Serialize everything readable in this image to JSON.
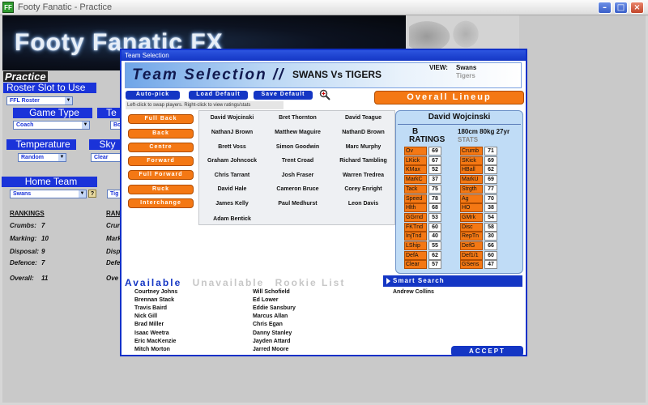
{
  "window": {
    "title": "Footy Fanatic - Practice",
    "icon": "FF"
  },
  "banner": {
    "title": "Footy Fanatic FX"
  },
  "left": {
    "heading": "Practice",
    "roster_label": "Roster Slot to Use",
    "roster_value": "FFL Roster",
    "game_type_label": "Game Type",
    "game_type_value": "Coach",
    "te_label": "Te",
    "te_value": "Bo",
    "temperature_label": "Temperature",
    "temperature_value": "Random",
    "sky_label": "Sky",
    "sky_value": "Clear",
    "home_team_label": "Home Team",
    "home_team_value": "Swans",
    "home_team_q": "?",
    "away_team_value": "Tig",
    "rankings_label": "RANKINGS",
    "rankings_label2": "RAN",
    "rankings": [
      {
        "label": "Crumbs:",
        "value": "7",
        "label2": "Crur"
      },
      {
        "label": "Marking:",
        "value": "10",
        "label2": "Mark"
      },
      {
        "label": "Disposal:",
        "value": "9",
        "label2": "Disp"
      },
      {
        "label": "Defence:",
        "value": "7",
        "label2": "Defe"
      }
    ],
    "overall_label": "Overall:",
    "overall_value": "11",
    "overall_label2": "Ove"
  },
  "dialog": {
    "title": "Team Selection",
    "header_title": "Team Selection //",
    "matchup": "SWANS Vs TIGERS",
    "view_label": "VIEW:",
    "view_primary": "Swans",
    "view_secondary": "Tigers",
    "buttons": {
      "autopick": "Auto-pick",
      "load": "Load Default",
      "save": "Save Default",
      "overall": "Overall Lineup",
      "accept": "ACCEPT"
    },
    "hint": "Left-click to swap players. Right-click to view ratings/stats",
    "positions": [
      "Full Back",
      "Back",
      "Centre",
      "Forward",
      "Full Forward",
      "Ruck",
      "Interchange"
    ],
    "grid": [
      [
        "David Wojcinski",
        "Bret Thornton",
        "David Teague"
      ],
      [
        "NathanJ Brown",
        "Matthew Maguire",
        "NathanD Brown"
      ],
      [
        "Brett Voss",
        "Simon Goodwin",
        "Marc Murphy"
      ],
      [
        "Graham Johncock",
        "Trent Croad",
        "Richard Tambling"
      ],
      [
        "Chris Tarrant",
        "Josh Fraser",
        "Warren Tredrea"
      ],
      [
        "David Hale",
        "Cameron Bruce",
        "Corey Enright"
      ],
      [
        "James Kelly",
        "Paul Medhurst",
        "Leon Davis"
      ],
      [
        "Adam Bentick",
        "",
        ""
      ]
    ],
    "player": {
      "name": "David Wojcinski",
      "b": "B",
      "ratings_label": "RATINGS",
      "physical": "180cm 80kg 27yr",
      "stats_label": "STATS",
      "left_ratings": [
        {
          "label": "Ov",
          "value": "69"
        },
        {
          "label": "LKick",
          "value": "67"
        },
        {
          "label": "KMax",
          "value": "52"
        },
        {
          "label": "MarkC",
          "value": "37"
        },
        {
          "label": "Tack",
          "value": "75"
        },
        {
          "label": "Speed",
          "value": "78"
        },
        {
          "label": "Hlth",
          "value": "68"
        },
        {
          "label": "GGrnd",
          "value": "53"
        },
        {
          "label": "FKTnd",
          "value": "60"
        },
        {
          "label": "InjTnd",
          "value": "40"
        },
        {
          "label": "LShip",
          "value": "55"
        },
        {
          "label": "DefA",
          "value": "62"
        },
        {
          "label": "Clear",
          "value": "57"
        }
      ],
      "right_ratings": [
        {
          "label": "Crumb",
          "value": "71"
        },
        {
          "label": "SKick",
          "value": "69"
        },
        {
          "label": "HBall",
          "value": "62"
        },
        {
          "label": "MarkU",
          "value": "69"
        },
        {
          "label": "Strgth",
          "value": "77"
        },
        {
          "label": "Ag",
          "value": "70"
        },
        {
          "label": "HO",
          "value": "38"
        },
        {
          "label": "GMrk",
          "value": "54"
        },
        {
          "label": "Disc",
          "value": "58"
        },
        {
          "label": "RepTn",
          "value": "30"
        },
        {
          "label": "DefG",
          "value": "66"
        },
        {
          "label": "Def1/1",
          "value": "60"
        },
        {
          "label": "GSens",
          "value": "47"
        }
      ]
    },
    "tabs": {
      "available": "Available",
      "unavailable": "Unavailable",
      "rookie": "Rookie List"
    },
    "available_col1": [
      "Courtney Johns",
      "Brennan Stack",
      "Travis Baird",
      "Nick Gill",
      "Brad Miller",
      "Isaac Weetra",
      "Eric MacKenzie",
      "Mitch Morton"
    ],
    "available_col2": [
      "Will Schofield",
      "Ed Lower",
      "Eddie Sansbury",
      "Marcus Allan",
      "Chris Egan",
      "Danny Stanley",
      "Jayden Attard",
      "Jarred Moore"
    ],
    "smart_search": "Smart Search",
    "search_result": "Andrew Collins"
  }
}
